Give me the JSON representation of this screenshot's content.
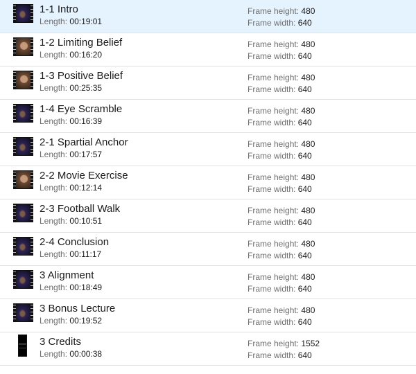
{
  "labels": {
    "length": "Length:",
    "frame_height": "Frame height:",
    "frame_width": "Frame width:"
  },
  "items": [
    {
      "title": "1-1 Intro",
      "length": "00:19:01",
      "frame_height": "480",
      "frame_width": "640",
      "thumb": "stage"
    },
    {
      "title": "1-2 Limiting Belief",
      "length": "00:16:20",
      "frame_height": "480",
      "frame_width": "640",
      "thumb": "face"
    },
    {
      "title": "1-3 Positive Belief",
      "length": "00:25:35",
      "frame_height": "480",
      "frame_width": "640",
      "thumb": "face"
    },
    {
      "title": "1-4 Eye Scramble",
      "length": "00:16:39",
      "frame_height": "480",
      "frame_width": "640",
      "thumb": "stage"
    },
    {
      "title": "2-1 Spartial Anchor",
      "length": "00:17:57",
      "frame_height": "480",
      "frame_width": "640",
      "thumb": "stage"
    },
    {
      "title": "2-2 Movie Exercise",
      "length": "00:12:14",
      "frame_height": "480",
      "frame_width": "640",
      "thumb": "face"
    },
    {
      "title": "2-3 Football Walk",
      "length": "00:10:51",
      "frame_height": "480",
      "frame_width": "640",
      "thumb": "stage"
    },
    {
      "title": "2-4 Conclusion",
      "length": "00:11:17",
      "frame_height": "480",
      "frame_width": "640",
      "thumb": "stage"
    },
    {
      "title": "3 Alignment",
      "length": "00:18:49",
      "frame_height": "480",
      "frame_width": "640",
      "thumb": "stage"
    },
    {
      "title": "3 Bonus Lecture",
      "length": "00:19:52",
      "frame_height": "480",
      "frame_width": "640",
      "thumb": "stage"
    },
    {
      "title": "3 Credits",
      "length": "00:00:38",
      "frame_height": "1552",
      "frame_width": "640",
      "thumb": "portrait"
    }
  ],
  "colors": {
    "title": "#1a1a1a",
    "label": "#6d6d6d",
    "divider": "#e1e1e1",
    "thumb_stage": "#2b2350",
    "thumb_face": "#6b4a34"
  }
}
